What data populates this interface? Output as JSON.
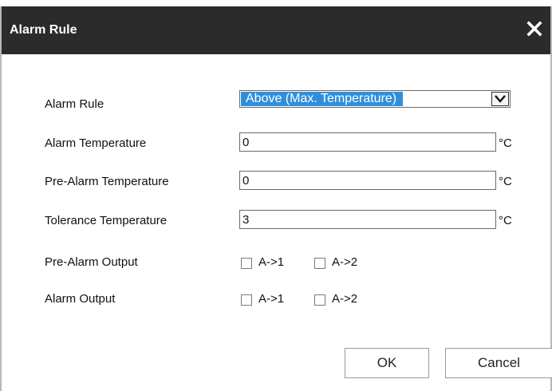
{
  "dialog": {
    "title": "Alarm Rule",
    "close_icon": "close-icon"
  },
  "form": {
    "alarm_rule": {
      "label": "Alarm Rule",
      "selected": "Above (Max. Temperature)",
      "arrow_icon": "chevron-down-icon"
    },
    "alarm_temperature": {
      "label": "Alarm Temperature",
      "value": "0",
      "unit": "°C"
    },
    "pre_alarm_temperature": {
      "label": "Pre-Alarm Temperature",
      "value": "0",
      "unit": "°C"
    },
    "tolerance_temperature": {
      "label": "Tolerance Temperature",
      "value": "3",
      "unit": "°C"
    },
    "pre_alarm_output": {
      "label": "Pre-Alarm Output",
      "options": [
        {
          "label": "A->1",
          "checked": false
        },
        {
          "label": "A->2",
          "checked": false
        }
      ]
    },
    "alarm_output": {
      "label": "Alarm Output",
      "options": [
        {
          "label": "A->1",
          "checked": false
        },
        {
          "label": "A->2",
          "checked": false
        }
      ]
    }
  },
  "buttons": {
    "ok": "OK",
    "cancel": "Cancel"
  }
}
